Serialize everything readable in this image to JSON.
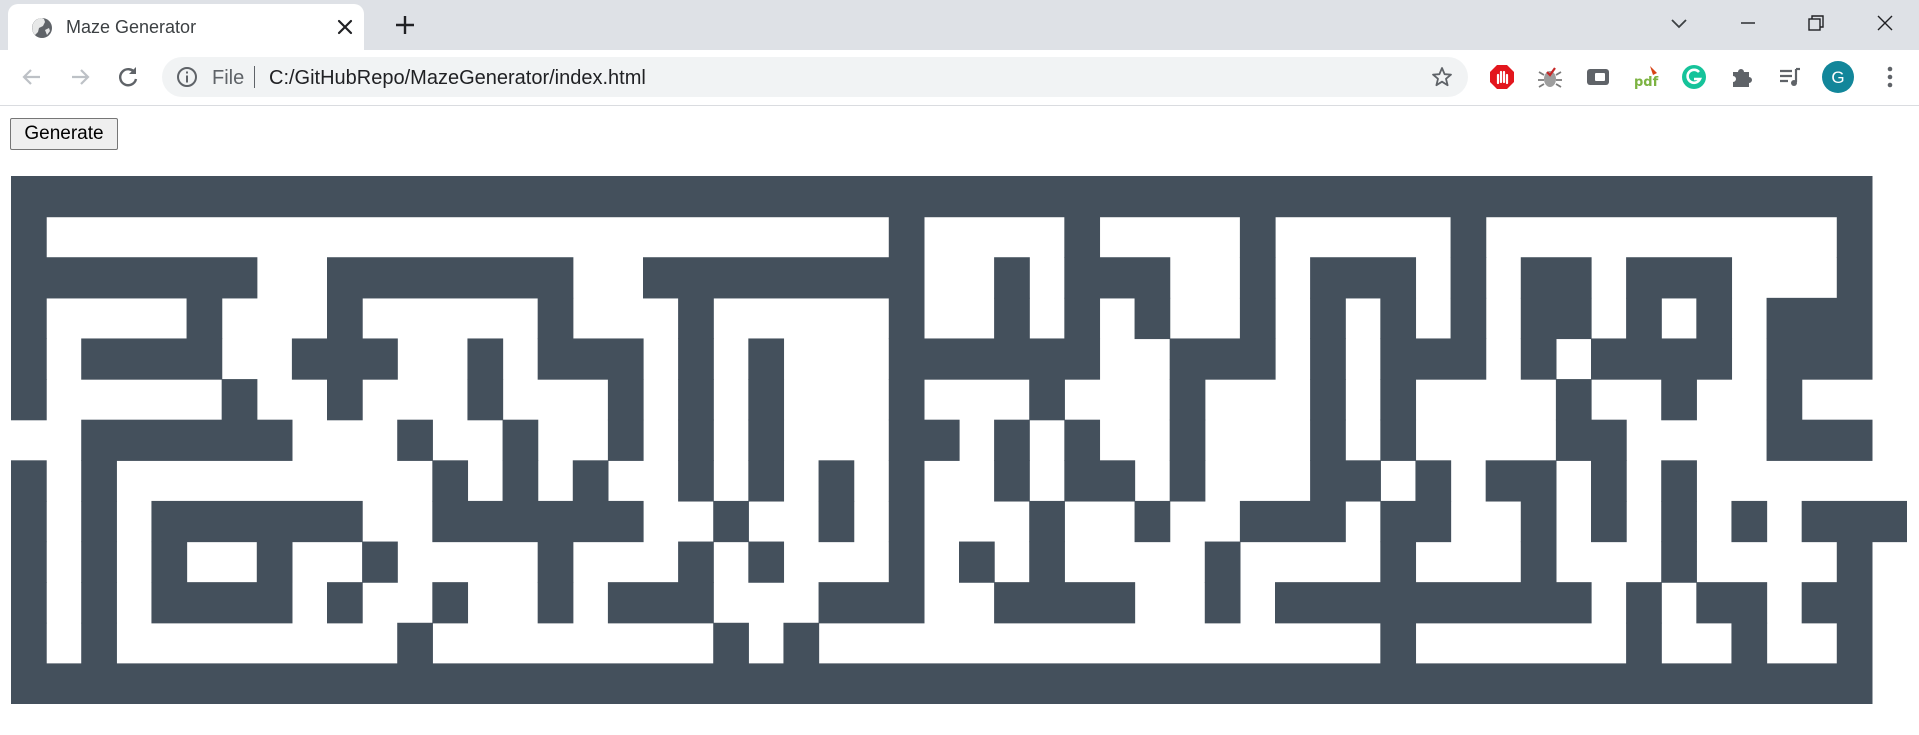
{
  "browser": {
    "tab": {
      "title": "Maze Generator",
      "favicon": "globe-icon"
    },
    "omnibox": {
      "scheme_label": "File",
      "url": "C:/GitHubRepo/MazeGenerator/index.html"
    },
    "profile_initial": "G",
    "extensions": [
      "adblock-icon",
      "bug-icon",
      "cast-icon",
      "pdf-icon",
      "grammarly-icon",
      "puzzle-icon",
      "media-queue-icon"
    ]
  },
  "page": {
    "generate_label": "Generate",
    "maze": {
      "wall_color": "#44505c",
      "path_color": "#ffffff",
      "rows": [
        "#####################################################",
        "#                        #    #    #     #          #",
        "#######  #######  ########  # ###  # ### # ## ###   #",
        "#    #   #     #   #     #  # # #  # # # # ## # # ###",
        "# ####  ###  # ### # #   ######  ### # ### # #### ###",
        "#     #  #   #   # # #   #   #   #   # #    #  #  #",
        "  ######   #  #  # # #   ## # #  #   # #    ##    ###",
        "# #         # # #  # # # #  # ## #   ## # ## # #",
        "# # ######  ######  #  # #   #  #  ### ##  # # # # ###",
        "# # #  #  #    #   # #   # # #    #    #   #   #    #",
        "# # #### #  #  # ###   ###  ####  # ######### # ## ##",
        "# #        #        # #                #      #  #  #",
        "#####################################################"
      ]
    }
  }
}
